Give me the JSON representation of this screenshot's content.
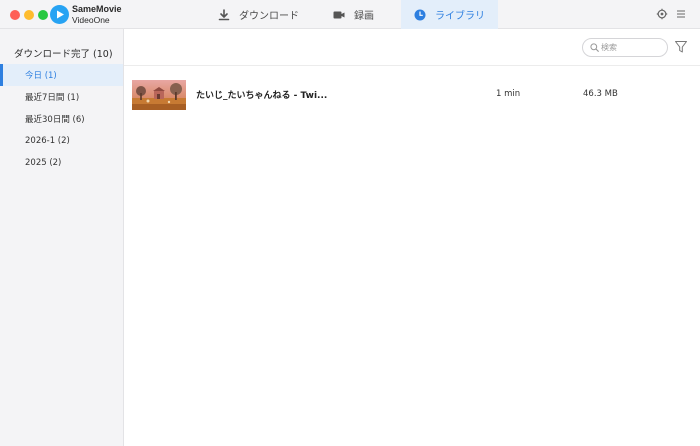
{
  "app": {
    "name_line1": "SameMovie",
    "name_line2": "VideoOne"
  },
  "tabs": [
    {
      "label": "ダウンロード",
      "icon": "download-icon",
      "active": false
    },
    {
      "label": "録画",
      "icon": "video-camera-icon",
      "active": false
    },
    {
      "label": "ライブラリ",
      "icon": "clock-icon",
      "active": true
    }
  ],
  "titlebar_icons": [
    "gear-icon",
    "menu-icon"
  ],
  "sidebar": {
    "header": "ダウンロード完了 (10)",
    "items": [
      {
        "label": "今日 (1)",
        "active": true
      },
      {
        "label": "最近7日間 (1)",
        "active": false
      },
      {
        "label": "最近30日間 (6)",
        "active": false
      },
      {
        "label": "2026-1 (2)",
        "active": false
      },
      {
        "label": "2025 (2)",
        "active": false
      }
    ]
  },
  "search": {
    "placeholder": "検索",
    "value": ""
  },
  "rows": [
    {
      "title": "たいじ_たいちゃんねる - Twi...",
      "duration": "1 min",
      "size": "46.3 MB"
    }
  ],
  "colors": {
    "accent": "#2d7fe0",
    "active_bg": "#e3eefa",
    "sidebar_bg": "#f4f4f6"
  }
}
